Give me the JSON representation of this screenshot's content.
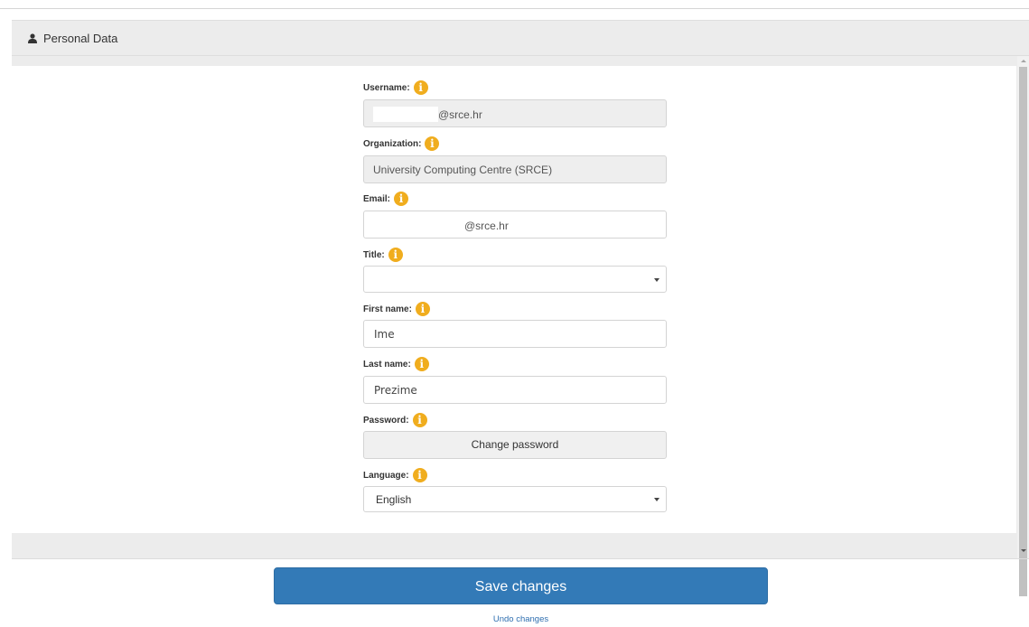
{
  "panel": {
    "title": "Personal Data",
    "icon": "user-icon"
  },
  "fields": {
    "username": {
      "label": "Username:",
      "value_suffix": "@srce.hr"
    },
    "organization": {
      "label": "Organization:",
      "value": "University Computing Centre (SRCE)"
    },
    "email": {
      "label": "Email:",
      "value_suffix": "@srce.hr"
    },
    "title": {
      "label": "Title:",
      "value": ""
    },
    "first_name": {
      "label": "First name:",
      "value": "Ime"
    },
    "last_name": {
      "label": "Last name:",
      "value": "Prezime"
    },
    "password": {
      "label": "Password:",
      "button_label": "Change password"
    },
    "language": {
      "label": "Language:",
      "value": "English"
    }
  },
  "info_icon_glyph": "i",
  "actions": {
    "save_label": "Save changes",
    "undo_label": "Undo changes"
  },
  "colors": {
    "primary": "#337ab7",
    "info": "#f0ad1e"
  }
}
